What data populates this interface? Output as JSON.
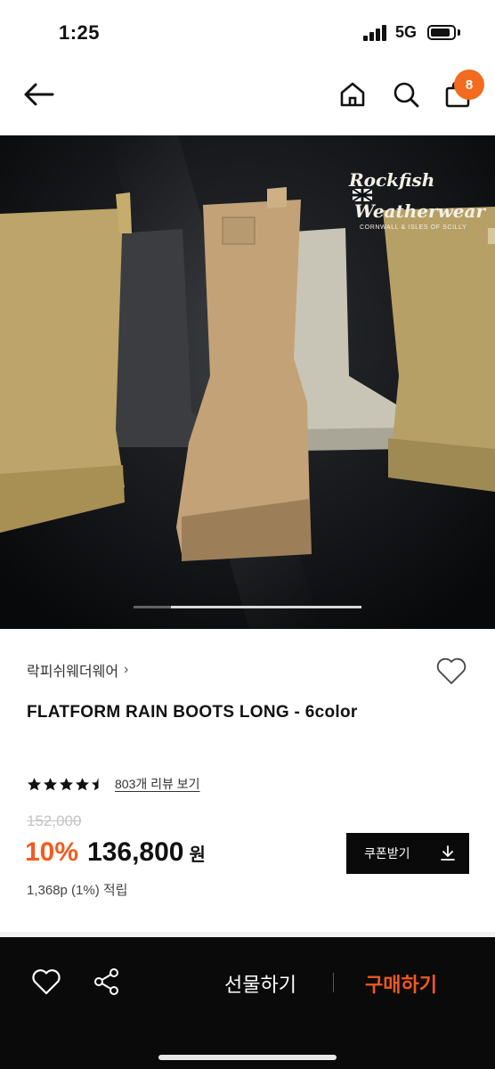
{
  "status_bar": {
    "time": "1:25",
    "network": "5G"
  },
  "nav": {
    "back_icon": "arrow-left-icon",
    "home_icon": "home-icon",
    "search_icon": "search-icon",
    "cart_icon": "shopping-bag-icon",
    "cart_count": "8"
  },
  "hero": {
    "logo_line1": "Rockfish",
    "logo_line2": "Weatherwear",
    "logo_sub": "CORNWALL & ISLES OF SCILLY",
    "slide_position": 0.5
  },
  "product": {
    "brand": "락피쉬웨더웨어",
    "brand_chevron": "›",
    "title": "FLATFORM RAIN BOOTS LONG - 6color",
    "rating": 4.5,
    "review_link": "803개 리뷰 보기",
    "original_price": "152,000",
    "discount": "10%",
    "sale_price": "136,800",
    "currency": "원",
    "coupon_label": "쿠폰받기",
    "points": "1,368p (1%) 적립"
  },
  "bottom_bar": {
    "gift_label": "선물하기",
    "buy_label": "구매하기"
  },
  "colors": {
    "accent": "#f25c1f",
    "badge": "#f26b1f",
    "dark": "#0a0a0a"
  }
}
